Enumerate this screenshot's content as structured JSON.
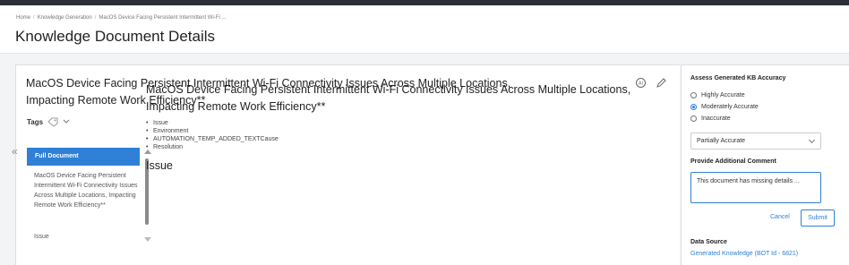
{
  "breadcrumb": {
    "items": [
      "Home",
      "Knowledge Generation",
      "MacOS Device Facing Persistent Intermittent Wi-Fi ..."
    ]
  },
  "page": {
    "title": "Knowledge Document Details"
  },
  "document": {
    "title": "MacOS Device Facing Persistent Intermittent Wi-Fi Connectivity Issues Across Multiple Locations, Impacting Remote Work Efficiency**",
    "tags_label": "Tags"
  },
  "toc": {
    "active": "Full Document",
    "item": "MacOS Device Facing Persistent Intermittent Wi-Fi Connectivity Issues Across Multiple Locations, Impacting Remote Work Efficiency**",
    "issue": "Issue"
  },
  "content": {
    "title": "MacOS Device Facing Persistent Intermittent Wi-Fi Connectivity Issues Across Multiple Locations, Impacting Remote Work Efficiency**",
    "list": [
      "Issue",
      "Environment",
      "",
      "AUTOMATION_TEMP_ADDED_TEXTCause",
      "Resolution"
    ],
    "section_heading": "Issue"
  },
  "side": {
    "accuracy_heading": "Assess Generated KB Accuracy",
    "options": [
      "Highly Accurate",
      "Moderately Accurate",
      "Inaccurate"
    ],
    "selected_option": "Moderately Accurate",
    "select_value": "Partially Accurate",
    "comment_heading": "Provide Additional Comment",
    "comment_value": "This document has missing details ...",
    "cancel_label": "Cancel",
    "submit_label": "Submit",
    "data_source_heading": "Data Source",
    "data_source_link": "Generated Knowledge (BOT Id - 6821)"
  },
  "colors": {
    "accent": "#2f80d6",
    "topbar": "#2b2f38"
  }
}
